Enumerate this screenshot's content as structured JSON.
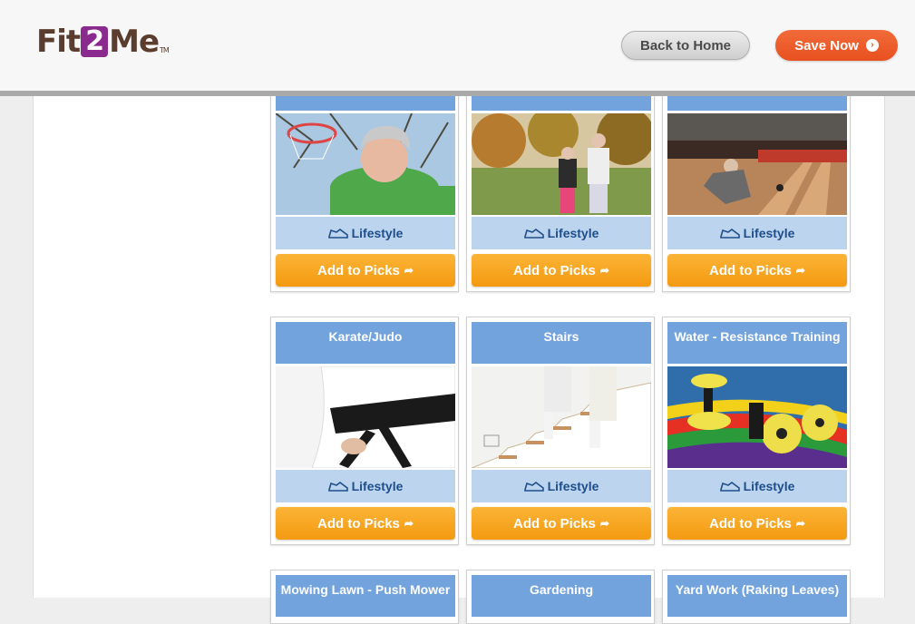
{
  "header": {
    "logo": {
      "pre": "Fit",
      "two": "2",
      "post": "Me",
      "tm": "TM"
    },
    "back_home": "Back to Home",
    "save_now": "Save Now",
    "save_icon": "›"
  },
  "badge_label": "Lifestyle",
  "add_label": "Add to Picks",
  "add_icon": "➦",
  "cards": [
    {
      "title": "",
      "image": "basketball-hoop-woman-photo"
    },
    {
      "title": "",
      "image": "couple-walking-park-photo"
    },
    {
      "title": "",
      "image": "bowling-alley-photo"
    },
    {
      "title": "Karate/Judo",
      "image": "black-belt-gi-photo"
    },
    {
      "title": "Stairs",
      "image": "couple-climbing-stairs-photo"
    },
    {
      "title": "Water - Resistance Training",
      "image": "foam-dumbbells-noodles-photo"
    },
    {
      "title": "Mowing Lawn - Push Mower",
      "image": ""
    },
    {
      "title": "Gardening",
      "image": ""
    },
    {
      "title": "Yard Work (Raking Leaves)",
      "image": ""
    }
  ]
}
